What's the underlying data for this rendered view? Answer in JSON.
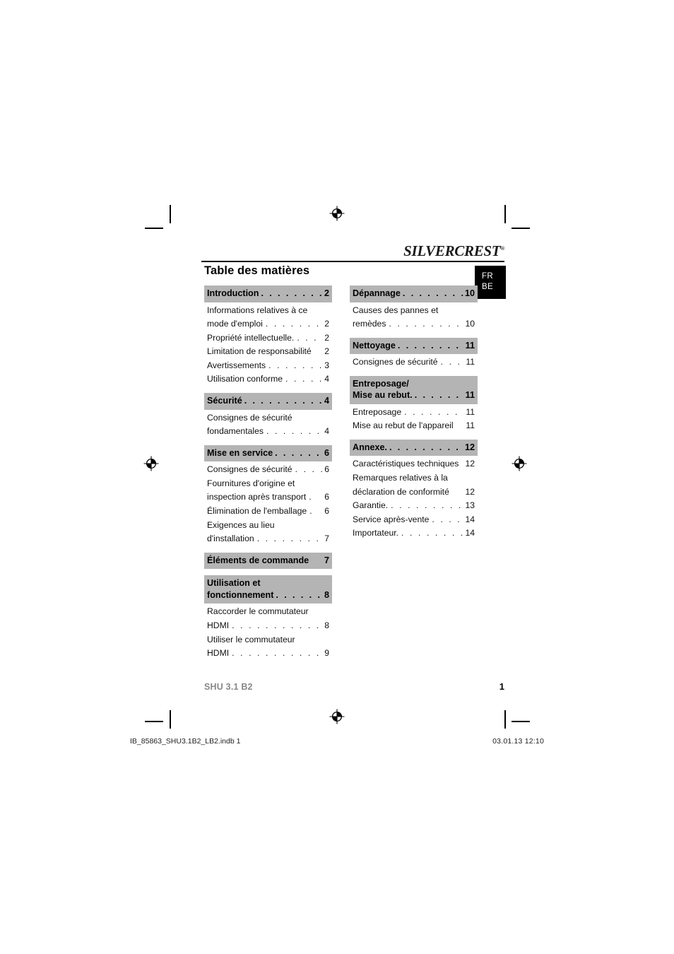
{
  "brand": {
    "logo_first": "SILVER",
    "logo_second": "CREST",
    "trademark": "®"
  },
  "page_title": "Table des matières",
  "language_tab": {
    "line1": "FR",
    "line2": "BE"
  },
  "footer": {
    "model": "SHU 3.1 B2",
    "page_number": "1"
  },
  "print_slug": {
    "filename": "IB_85863_SHU3.1B2_LB2.indb   1",
    "datetime": "03.01.13   12:10"
  },
  "colors": {
    "section_bar": "#b4b4b4",
    "lang_tab_bg": "#000000",
    "footer_model": "#878787"
  },
  "toc": {
    "left_column": [
      {
        "type": "section",
        "title": "Introduction",
        "page": "2",
        "leader": ". . . . . . . . ."
      },
      {
        "type": "entry",
        "line1": "Informations relatives à ce",
        "title": "mode d'emploi",
        "page": "2",
        "leader": ". . . . . . . . ."
      },
      {
        "type": "entry",
        "title": "Propriété intellectuelle.",
        "page": "2",
        "leader": ". . . . ."
      },
      {
        "type": "entry",
        "title": "Limitation de responsabilité",
        "page": "2",
        "leader": ""
      },
      {
        "type": "entry",
        "title": "Avertissements",
        "page": "3",
        "leader": ". . . . . . . . ."
      },
      {
        "type": "entry",
        "title": "Utilisation conforme",
        "page": "4",
        "leader": ". . . . . ."
      },
      {
        "type": "section",
        "title": "Sécurité",
        "page": "4",
        "leader": ". . . . . . . . . . .",
        "gap": true
      },
      {
        "type": "entry",
        "line1": "Consignes de sécurité",
        "title": "fondamentales",
        "page": "4",
        "leader": ". . . . . . . . ."
      },
      {
        "type": "section",
        "title": "Mise en service",
        "page": "6",
        "leader": ". . . . . .",
        "gap": true
      },
      {
        "type": "entry",
        "title": "Consignes de sécurité",
        "page": "6",
        "leader": ". . . ."
      },
      {
        "type": "entry",
        "line1": "Fournitures d'origine et",
        "title": "inspection après transport",
        "page": "6",
        "leader": "."
      },
      {
        "type": "entry",
        "title": "Élimination de l'emballage",
        "page": "6",
        "leader": "."
      },
      {
        "type": "entry",
        "line1": "Exigences au lieu",
        "title": "d'installation",
        "page": "7",
        "leader": ". . . . . . . . . . ."
      },
      {
        "type": "section",
        "title": "Éléments de commande",
        "page": "7",
        "leader": "",
        "gap": true
      },
      {
        "type": "section",
        "line1": "Utilisation et",
        "title": "fonctionnement",
        "page": "8",
        "leader": ". . . . . .",
        "gap": true
      },
      {
        "type": "entry",
        "line1": "Raccorder le commutateur",
        "title": "HDMI",
        "page": "8",
        "leader": ". . . . . . . . . . . . . . ."
      },
      {
        "type": "entry",
        "line1": "Utiliser le commutateur",
        "title": "HDMI",
        "page": "9",
        "leader": ". . . . . . . . . . . . . . ."
      }
    ],
    "right_column": [
      {
        "type": "section",
        "title": "Dépannage",
        "page": "10",
        "leader": ". . . . . . . ."
      },
      {
        "type": "entry",
        "line1": "Causes des pannes et",
        "title": "remèdes",
        "page": "10",
        "leader": ". . . . . . . . . . . ."
      },
      {
        "type": "section",
        "title": "Nettoyage",
        "page": "11",
        "leader": ". . . . . . . . .",
        "gap": true
      },
      {
        "type": "entry",
        "title": "Consignes de sécurité",
        "page": "11",
        "leader": ". . ."
      },
      {
        "type": "section",
        "line1": "Entreposage/",
        "title": "Mise au rebut.",
        "page": "11",
        "leader": ". . . . . .",
        "gap": true
      },
      {
        "type": "entry",
        "title": "Entreposage",
        "page": "11",
        "leader": ". . . . . . . . . ."
      },
      {
        "type": "entry",
        "title": "Mise au rebut de l'appareil",
        "page": "11",
        "leader": ""
      },
      {
        "type": "section",
        "title": "Annexe.",
        "page": "12",
        "leader": ". . . . . . . . . . .",
        "gap": true
      },
      {
        "type": "entry",
        "title": "Caractéristiques techniques",
        "page": "12",
        "leader": ""
      },
      {
        "type": "entry",
        "line1": "Remarques relatives à la",
        "title": "déclaration de conformité",
        "page": "12",
        "leader": ""
      },
      {
        "type": "entry",
        "title": "Garantie.",
        "page": "13",
        "leader": ". . . . . . . . . . . ."
      },
      {
        "type": "entry",
        "title": "Service après-vente",
        "page": "14",
        "leader": ". . . . ."
      },
      {
        "type": "entry",
        "title": "Importateur.",
        "page": "14",
        "leader": ". . . . . . . . . . ."
      }
    ]
  }
}
